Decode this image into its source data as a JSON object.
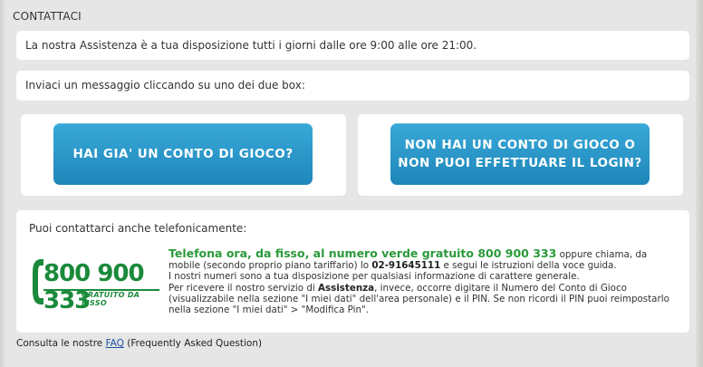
{
  "page": {
    "title": "CONTATTACI"
  },
  "hours_box": {
    "text": "La nostra Assistenza è a tua disposizione tutti i giorni dalle ore 9:00 alle ore 21:00."
  },
  "message_box": {
    "text": "Inviaci un messaggio cliccando su uno dei due box:"
  },
  "buttons": {
    "have_account": "HAI GIA' UN CONTO DI GIOCO?",
    "no_account_line1": "NON HAI UN CONTO DI GIOCO O",
    "no_account_line2": "NON PUOI EFFETTUARE IL LOGIN?"
  },
  "phone": {
    "intro": "Puoi contattarci anche telefonicamente:",
    "logo_number": "800 900 333",
    "logo_caption": "GRATUITO DA FISSO",
    "headline": "Telefona ora, da fisso, al numero verde gratuito 800 900 333",
    "after_headline": " oppure chiama, da mobile (secondo proprio piano tariffario) lo ",
    "mobile_number": "02-91645111",
    "after_mobile": " e segui le istruzioni della voce guida.",
    "line_numbers": "I nostri numeri sono a tua disposizione per qualsiasi informazione di carattere generale.",
    "service_prefix": "Per ricevere il nostro servizio di ",
    "service_word": "Assistenza",
    "service_suffix": ", invece, occorre digitare il Numero del Conto di Gioco (visualizzabile nella sezione \"I miei dati\" dell'area personale) e il PIN. Se non ricordi il PIN puoi reimpostarlo nella sezione \"I miei dati\" > \"Modifica Pin\"."
  },
  "footer": {
    "prefix": "Consulta le nostre ",
    "link": "FAQ",
    "suffix": " (Frequently Asked Question)"
  },
  "colors": {
    "button_blue": "#2596c9",
    "green": "#1a8a3a"
  }
}
